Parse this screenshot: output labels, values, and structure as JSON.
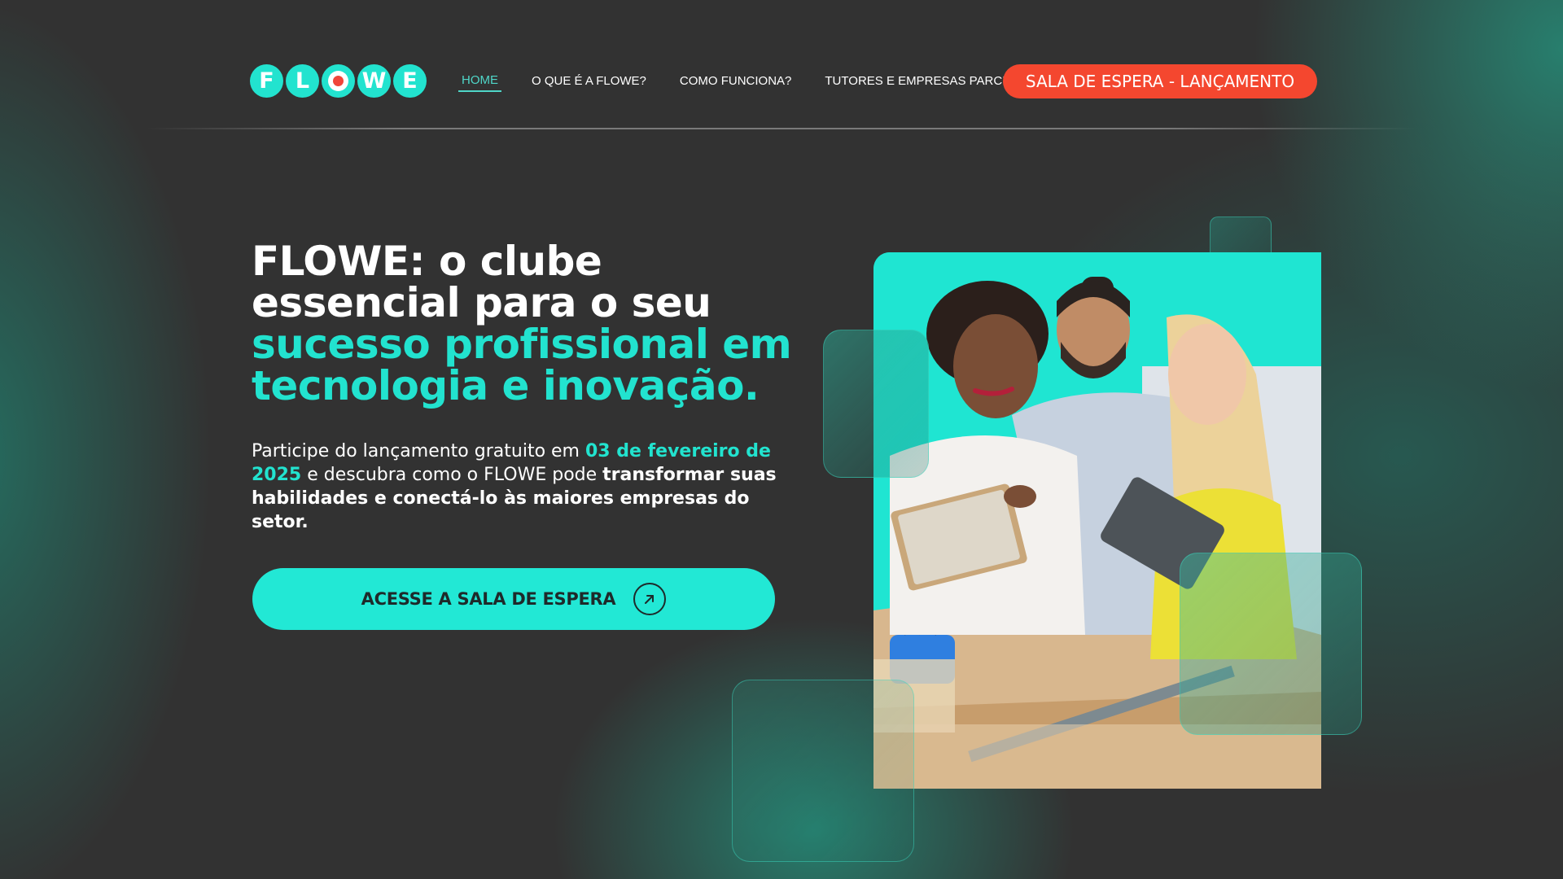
{
  "brand": {
    "logo_letters": [
      "F",
      "L",
      "W",
      "E"
    ],
    "logo_text": "FLOWE",
    "accent_color": "#22e3cf",
    "cta_color": "#f4472f"
  },
  "nav": {
    "items": [
      {
        "label": "HOME",
        "active": true
      },
      {
        "label": "O QUE É A FLOWE?",
        "active": false
      },
      {
        "label": "COMO FUNCIONA?",
        "active": false
      },
      {
        "label": "TUTORES E EMPRESAS PARCEIRAS",
        "active": false
      }
    ],
    "cta_label": "SALA DE ESPERA - LANÇAMENTO"
  },
  "hero": {
    "title": {
      "part1_bold": "FLOWE:",
      "part2": " o clube essencial para o seu ",
      "part3_accent": "sucesso profissional em tecnologia e inovação."
    },
    "subtitle": {
      "part1": "Participe do lançamento gratuito em ",
      "part2_accent": "03 de fevereiro de 2025",
      "part3": " e descubra como o FLOWE pode ",
      "part4_bold": "transformar suas habilidades e conectá-lo às maiores empresas do setor."
    },
    "cta_label": "ACESSE A SALA DE ESPERA",
    "cta_icon": "arrow-up-right-icon"
  },
  "image": {
    "subject": "three-people-with-tablets-photo"
  }
}
